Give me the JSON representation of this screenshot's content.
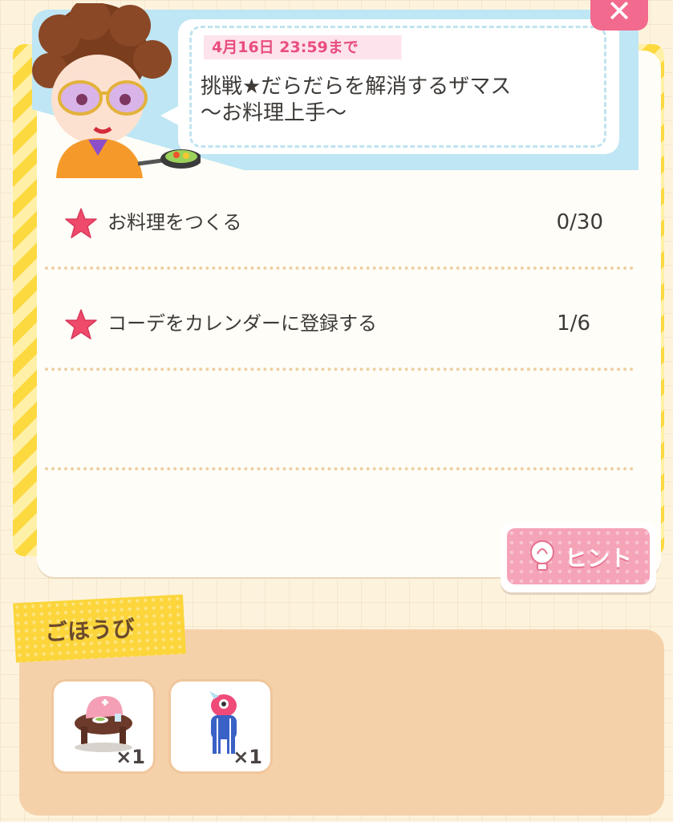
{
  "mission": {
    "deadline": "4月16日 23:59まで",
    "title_line1": "挑戦★だらだらを解消するザマス",
    "title_line2": "〜お料理上手〜"
  },
  "close_label": "✕",
  "tasks": [
    {
      "label": "お料理をつくる",
      "count": "0/30"
    },
    {
      "label": "コーデをカレンダーに登録する",
      "count": "1/6"
    }
  ],
  "hint": {
    "label": "ヒント"
  },
  "rewards": {
    "label": "ごほうび",
    "items": [
      {
        "icon": "table-furniture-icon",
        "qty": "×1"
      },
      {
        "icon": "pink-costume-icon",
        "qty": "×1"
      }
    ]
  },
  "colors": {
    "accent_pink": "#e94d7f",
    "frame_yellow": "#fcd93f",
    "header_blue": "#bfe6f4"
  }
}
